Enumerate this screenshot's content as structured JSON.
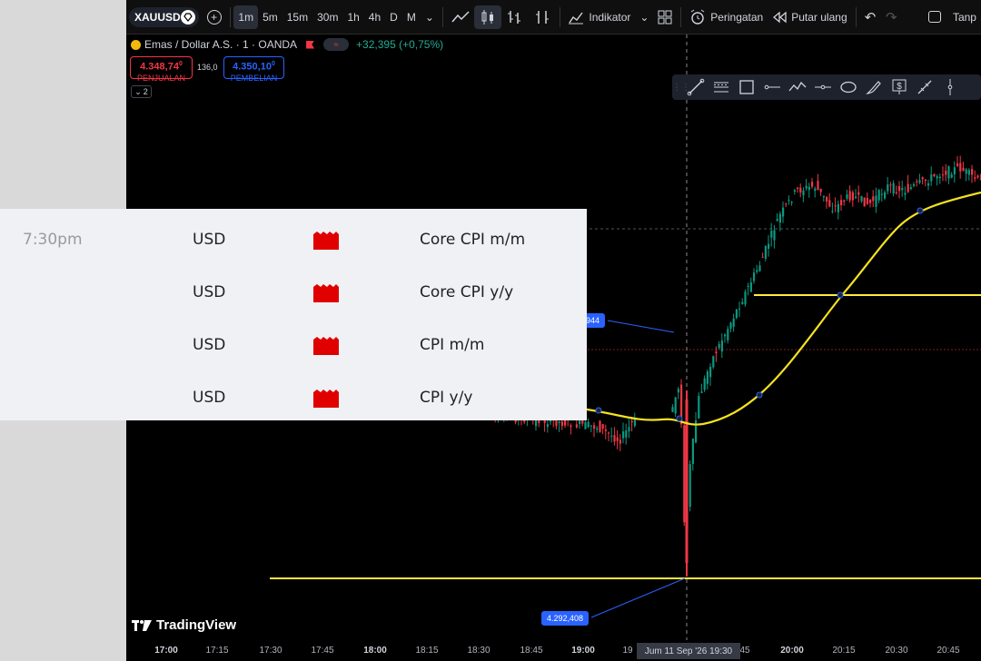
{
  "toolbar": {
    "symbol": "XAUUSD",
    "intervals": [
      "1m",
      "5m",
      "15m",
      "30m",
      "1h",
      "4h",
      "D",
      "M"
    ],
    "active_interval": "1m",
    "indicators_label": "Indikator",
    "alert_label": "Peringatan",
    "replay_label": "Putar ulang",
    "right_label": "Tanp"
  },
  "legend": {
    "title": "Emas / Dollar A.S. · 1 · OANDA",
    "change": "+32,395 (+0,75%)",
    "sell_price": "4.348,74",
    "sell_sup": "0",
    "sell_label": "PENJUALAN",
    "spread": "136,0",
    "buy_price": "4.350,10",
    "buy_sup": "0",
    "buy_label": "PEMBELIAN",
    "collapse_count": "2"
  },
  "colors": {
    "background": "#000000",
    "up_candle": "#089981",
    "down_candle": "#f23645",
    "ma_line": "#f5e21f",
    "horizontal_lines": "#ffeb3b",
    "price_tag": "#2962ff",
    "impact_red": "#e00000"
  },
  "price_tags": {
    "upper": "944",
    "lower": "4.292,408"
  },
  "time_axis": {
    "labels": [
      "17:00",
      "17:15",
      "17:30",
      "17:45",
      "18:00",
      "18:15",
      "18:30",
      "18:45",
      "19:00",
      "19",
      "45",
      "20:00",
      "20:15",
      "20:30",
      "20:45"
    ],
    "bold_labels": [
      "17:00",
      "18:00",
      "19:00",
      "20:00"
    ],
    "crosshair": "Jum 11 Sep '26   19:30"
  },
  "branding": "TradingView",
  "calendar": {
    "rows": [
      {
        "time": "7:30pm",
        "currency": "USD",
        "impact": "high-impact-icon",
        "event": "Core CPI m/m"
      },
      {
        "time": "",
        "currency": "USD",
        "impact": "high-impact-icon",
        "event": "Core CPI y/y"
      },
      {
        "time": "",
        "currency": "USD",
        "impact": "high-impact-icon",
        "event": "CPI m/m"
      },
      {
        "time": "",
        "currency": "USD",
        "impact": "high-impact-icon",
        "event": "CPI y/y"
      }
    ]
  }
}
